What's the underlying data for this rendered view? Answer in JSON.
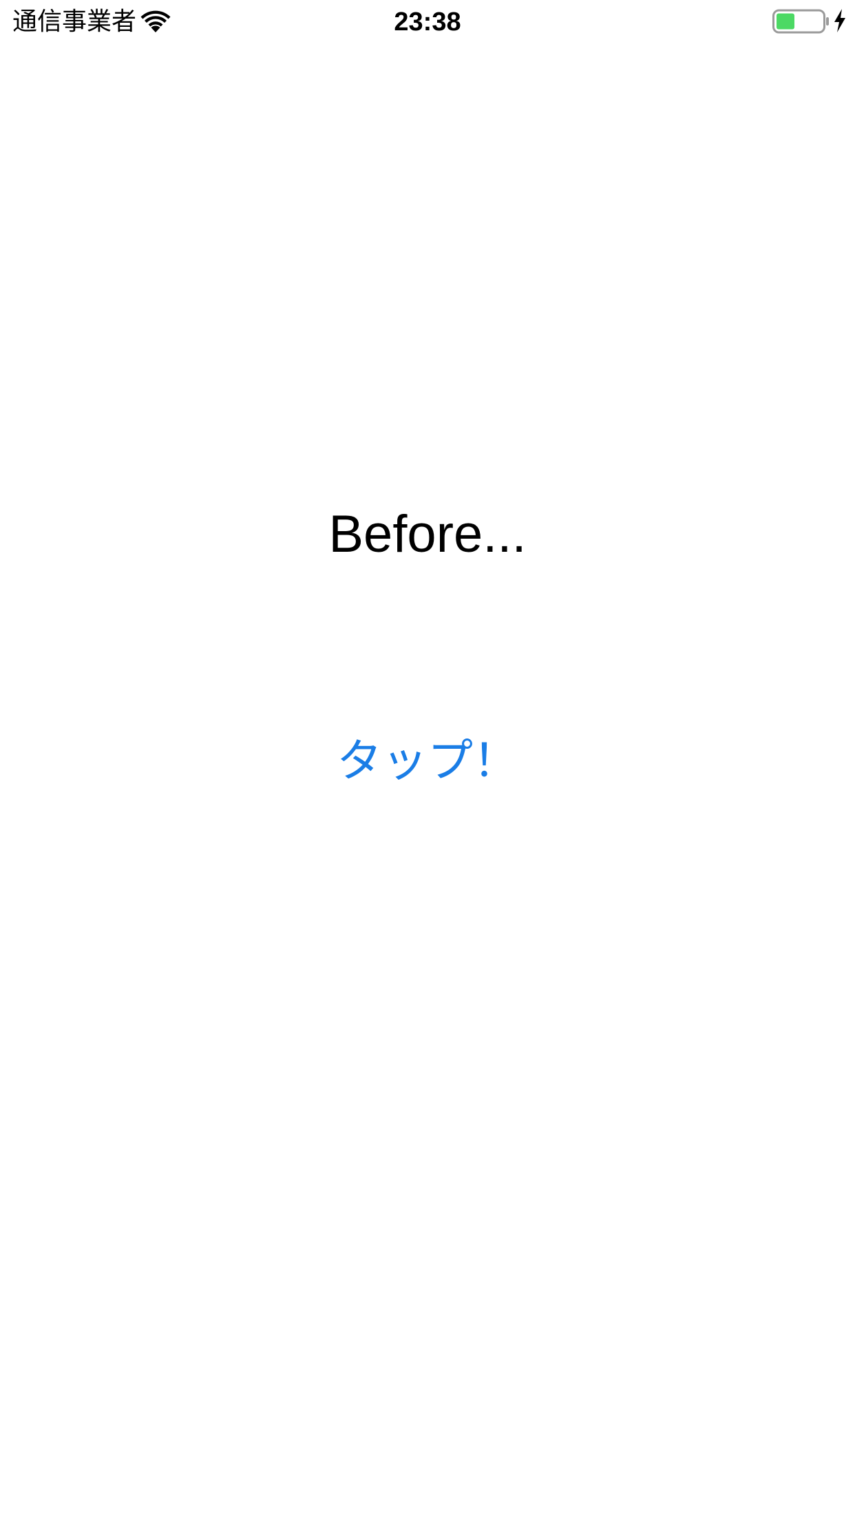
{
  "status_bar": {
    "carrier": "通信事業者",
    "time": "23:38",
    "wifi_icon": "wifi-icon",
    "battery_icon": "battery-icon",
    "charging_icon": "charging-bolt-icon",
    "battery_level": 0.4,
    "battery_color": "#4cd964"
  },
  "main": {
    "label": "Before...",
    "button_label": "タップ！",
    "button_color": "#1a7de6"
  }
}
